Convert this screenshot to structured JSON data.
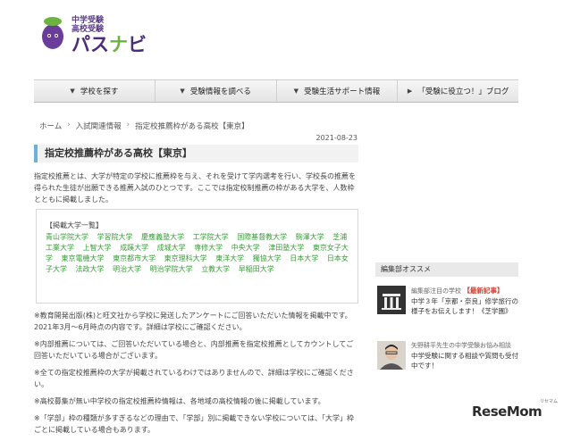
{
  "logo": {
    "line1": "中学受験",
    "line2": "高校受験",
    "main_left": "パス",
    "main_accent": "ナ",
    "main_right": "ビ"
  },
  "nav": [
    {
      "label": "学校を探す"
    },
    {
      "label": "受験情報を調べる"
    },
    {
      "label": "受験生活サポート情報"
    },
    {
      "label": "「受験に役立つ！」ブログ"
    }
  ],
  "breadcrumb": [
    "ホーム",
    "入試関連情報",
    "指定校推薦枠がある高校【東京】"
  ],
  "article": {
    "date": "2021-08-23",
    "title": "指定校推薦枠がある高校【東京】",
    "intro": "指定校推薦とは、大学が特定の学校に推薦枠を与え、それを受けて学内選考を行い、学校長の推薦を得られた生徒が出願できる推薦入試のひとつです。ここでは指定校制推薦の枠がある大学を、人数枠とともに掲載しました。",
    "box_head": "【掲載大学一覧】",
    "universities": [
      "青山学院大学",
      "学習院大学",
      "慶應義塾大学",
      "工学院大学",
      "国際基督教大学",
      "駒澤大学",
      "芝浦工業大学",
      "上智大学",
      "成蹊大学",
      "成城大学",
      "専修大学",
      "中央大学",
      "津田塾大学",
      "東京女子大学",
      "東京電機大学",
      "東京都市大学",
      "東京理科大学",
      "東洋大学",
      "獨協大学",
      "日本大学",
      "日本女子大学",
      "法政大学",
      "明治大学",
      "明治学院大学",
      "立教大学",
      "早稲田大学"
    ],
    "notes": [
      "※教育開発出版(株)と旺文社から学校に発送したアンケートにご回答いただいた情報を掲載中です。2021年3月～6月時点の内容です。詳細は学校にご確認ください。",
      "※内部推薦については、ご回答いただいている場合と、内部推薦を指定校推薦としてカウントしてご回答いただいている場合がございます。",
      "※全ての指定校推薦枠の大学が掲載されているわけではありませんので、詳細は学校にご確認ください。",
      "※高校募集が無い中学校の指定校推薦枠情報は、各地域の高校情報の後に掲載しています。",
      "※「学部」枠の種類が多すぎるなどの理由で、「学部」別に掲載できない学校については、「大学」枠ごとに掲載している場合もあります。"
    ]
  },
  "sidebar": {
    "heading": "編集部オススメ",
    "items": [
      {
        "label": "編集部注目の学校",
        "badge": "【最新記事】",
        "text": "中学３年「京都・奈良」修学旅行の様子をお伝えします！《芝学園》"
      },
      {
        "label": "矢野耕平先生の中学受験お悩み相談",
        "badge": "",
        "text": "中学受験に関する相談や質問も受付中です！"
      }
    ]
  },
  "watermark": {
    "brand": "ReseMom",
    "small": "リセマム"
  },
  "colors": {
    "accent_green": "#6db33f",
    "brand_purple": "#4b2e7a",
    "title_bar": "#6db0d8",
    "uni_link": "#3a9b3a"
  }
}
